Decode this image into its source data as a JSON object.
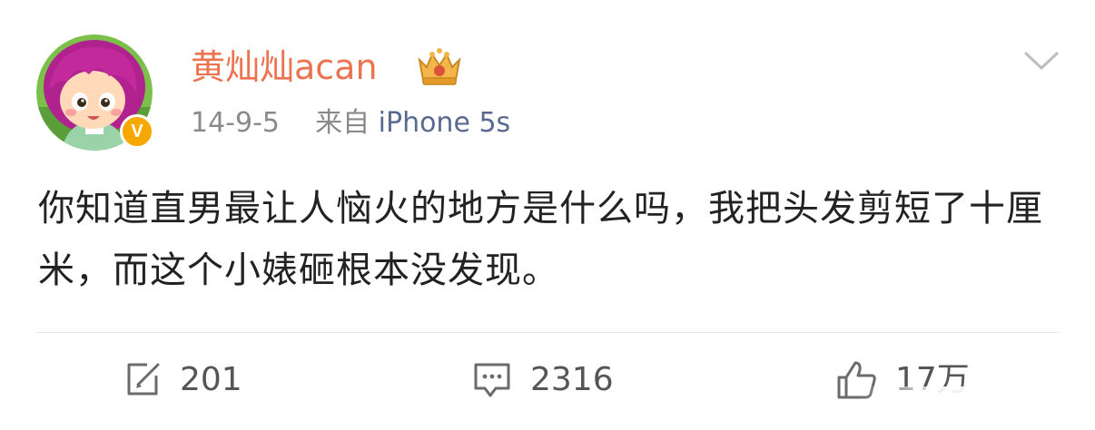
{
  "post": {
    "author": {
      "name": "黄灿灿acan",
      "avatar_icon": "cartoon-avatar",
      "verified_icon": "verified-v-badge",
      "verified_mark": "V",
      "member_icon": "vip-crown-icon",
      "name_color": "#eb7350"
    },
    "meta": {
      "date": "14-9-5",
      "source_prefix": "来自",
      "source_name": "iPhone 5s"
    },
    "text": "你知道直男最让人恼火的地方是什么吗，我把头发剪短了十厘米，而这个小婊砸根本没发现。",
    "actions": {
      "reposts": "201",
      "comments": "2316",
      "likes": "17万"
    }
  },
  "colors": {
    "accent": "#eb7350",
    "source_link": "#596a91",
    "text": "#222222",
    "muted": "#8a8a8a",
    "badge": "#f7a800"
  }
}
